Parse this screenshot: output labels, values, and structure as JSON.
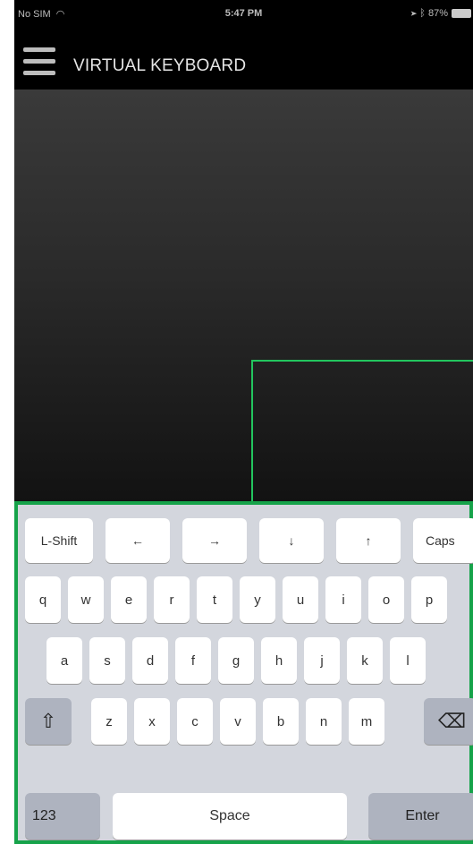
{
  "status_bar": {
    "carrier": "No SIM",
    "time": "5:47 PM",
    "battery": "87%"
  },
  "header": {
    "title": "VIRTUAL KEYBOARD"
  },
  "keyboard": {
    "row1": [
      "L-Shift",
      "←",
      "→",
      "↓",
      "↑",
      "Caps"
    ],
    "row2": [
      "q",
      "w",
      "e",
      "r",
      "t",
      "y",
      "u",
      "i",
      "o",
      "p"
    ],
    "row3": [
      "a",
      "s",
      "d",
      "f",
      "g",
      "h",
      "j",
      "k",
      "l"
    ],
    "row4": [
      "⇧",
      "z",
      "x",
      "c",
      "v",
      "b",
      "n",
      "m",
      "⌫"
    ],
    "row5": [
      "123",
      "Space",
      "Enter"
    ]
  },
  "colors": {
    "accent_green": "#16a34a",
    "touch_outline": "#22c55e"
  },
  "icons": {
    "menu": "hamburger-icon",
    "shift": "shift-icon",
    "backspace": "backspace-icon",
    "wifi": "wifi-icon"
  }
}
